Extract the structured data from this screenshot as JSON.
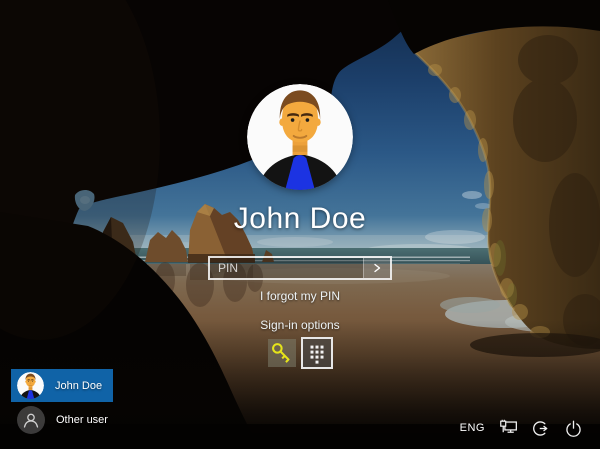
{
  "login": {
    "user_name": "John Doe",
    "pin_placeholder": "PIN",
    "forgot_link": "I forgot my PIN",
    "sign_in_options_label": "Sign-in options"
  },
  "user_list": {
    "items": [
      {
        "name": "John Doe",
        "selected": true
      },
      {
        "name": "Other user",
        "selected": false
      }
    ]
  },
  "status_bar": {
    "language": "ENG",
    "icons": [
      "network-wired-icon",
      "ease-of-access-icon",
      "power-icon"
    ]
  },
  "sign_in_options": {
    "icons": [
      "key-icon",
      "pin-pad-icon"
    ],
    "selected": "pin-pad-icon"
  },
  "icons": {
    "submit": "chevron-right-arrow",
    "key": "yellow-key",
    "pin_pad": "numeric-pad-dots",
    "other_user": "person-outline"
  },
  "colors": {
    "accent_blue": "#1063a7",
    "key_yellow": "#e6e41a",
    "selected_border": "#f0f0f0"
  }
}
